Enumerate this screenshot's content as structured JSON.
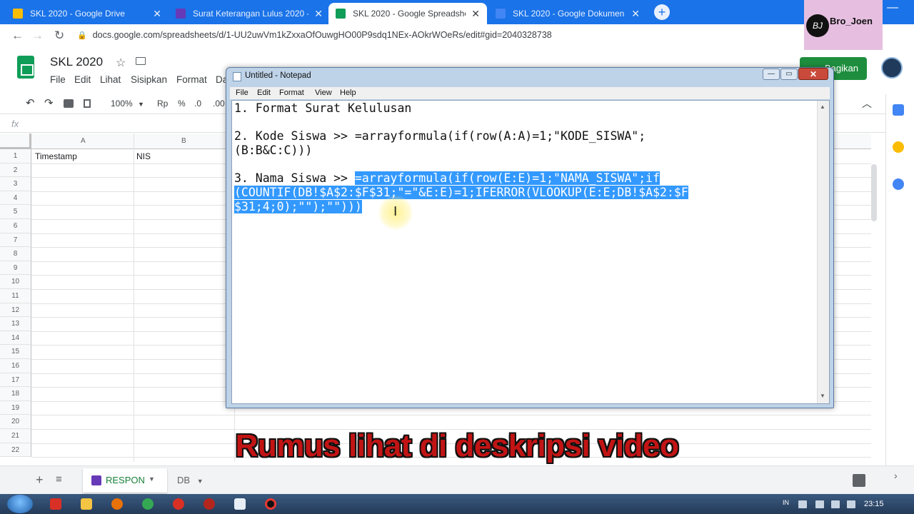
{
  "browser": {
    "tabs": [
      {
        "title": "SKL 2020 - Google Drive",
        "icon": "drive-icon",
        "color": "#fbbc04"
      },
      {
        "title": "Surat Keterangan Lulus 2020 - G",
        "icon": "forms-icon",
        "color": "#673ab7"
      },
      {
        "title": "SKL 2020 - Google Spreadsheet",
        "icon": "sheets-icon",
        "color": "#0f9d58"
      },
      {
        "title": "SKL 2020 - Google Dokumen",
        "icon": "docs-icon",
        "color": "#4285f4"
      }
    ],
    "url": "docs.google.com/spreadsheets/d/1-UU2uwVm1kZxxaOfOuwgHO00P9sdq1NEx-AOkrWOeRs/edit#gid=2040328738"
  },
  "watermark": {
    "badge": "BJ",
    "text": "Bro_Joen"
  },
  "sheets": {
    "title": "SKL 2020",
    "menus": [
      "File",
      "Edit",
      "Lihat",
      "Sisipkan",
      "Format",
      "Da"
    ],
    "share_label": "Bagikan",
    "toolbar": {
      "zoom": "100%",
      "currency": "Rp",
      "percent": "%",
      "decimal": ".0",
      "decimal2": ".00"
    },
    "fx": "fx",
    "columns": [
      "A",
      "B"
    ],
    "header_cells": [
      "Timestamp",
      "NIS"
    ],
    "rows": [
      "1",
      "2",
      "3",
      "4",
      "5",
      "6",
      "7",
      "8",
      "9",
      "10",
      "11",
      "12",
      "13",
      "14",
      "15",
      "16",
      "17",
      "18",
      "19",
      "20",
      "21",
      "22"
    ],
    "sheet_tabs": [
      {
        "label": "RESPON"
      },
      {
        "label": "DB"
      }
    ]
  },
  "notepad": {
    "title": "Untitled - Notepad",
    "menus": [
      "File",
      "Edit",
      "Format",
      "View",
      "Help"
    ],
    "close": "✕",
    "lines": {
      "l1": "1. Format Surat Kelulusan",
      "l2a": "2. Kode Siswa >> =arrayformula(if(row(A:A)=1;\"KODE_SISWA\";",
      "l2b": "(B:B&C:C)))",
      "l3_prefix": "3. Nama Siswa >> ",
      "l3_sel1": "=arrayformula(if(row(E:E)=1;\"NAMA_SISWA\";if",
      "l3_sel2": "(COUNTIF(DB!$A$2:$F$31;\"=\"&E:E)=1;IFERROR(VLOOKUP(E:E;DB!$A$2:$F",
      "l3_sel3": "$31;4;0);\"\");\"\")))"
    }
  },
  "caption": "Rumus lihat di deskripsi video",
  "taskbar": {
    "lang": "IN",
    "time": "23:15"
  }
}
